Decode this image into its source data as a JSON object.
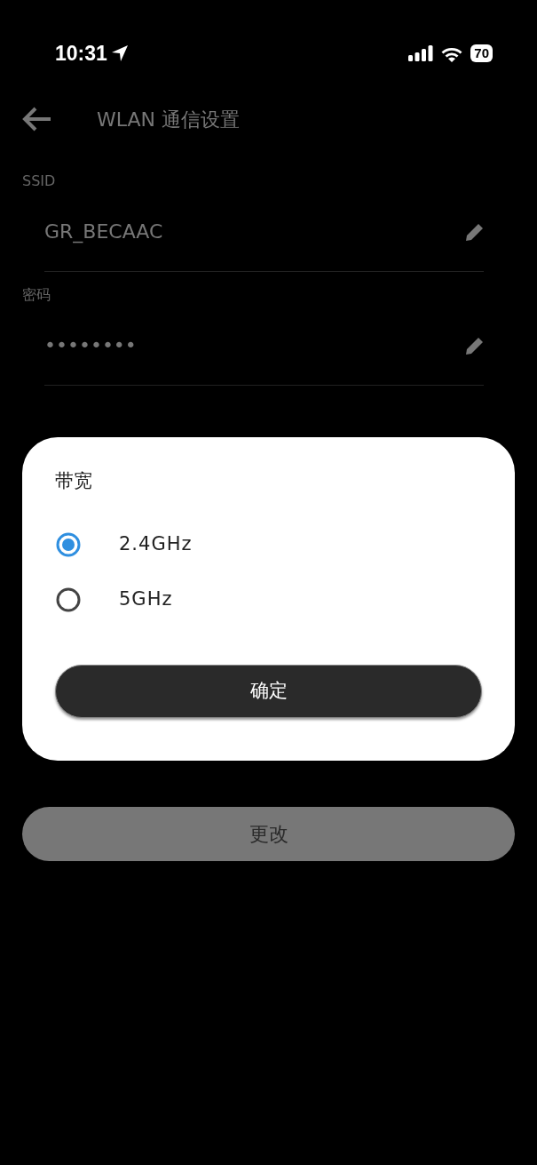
{
  "status_bar": {
    "time": "10:31",
    "battery": "70"
  },
  "header": {
    "title": "WLAN 通信设置"
  },
  "fields": [
    {
      "label": "SSID",
      "value": "GR_BECAAC"
    },
    {
      "label": "密码",
      "value": "••••••••"
    }
  ],
  "dialog": {
    "title": "带宽",
    "options": [
      {
        "label": "2.4GHz",
        "selected": true
      },
      {
        "label": "5GHz",
        "selected": false
      }
    ],
    "confirm": "确定"
  },
  "change_button": {
    "label": "更改",
    "disabled": true
  }
}
